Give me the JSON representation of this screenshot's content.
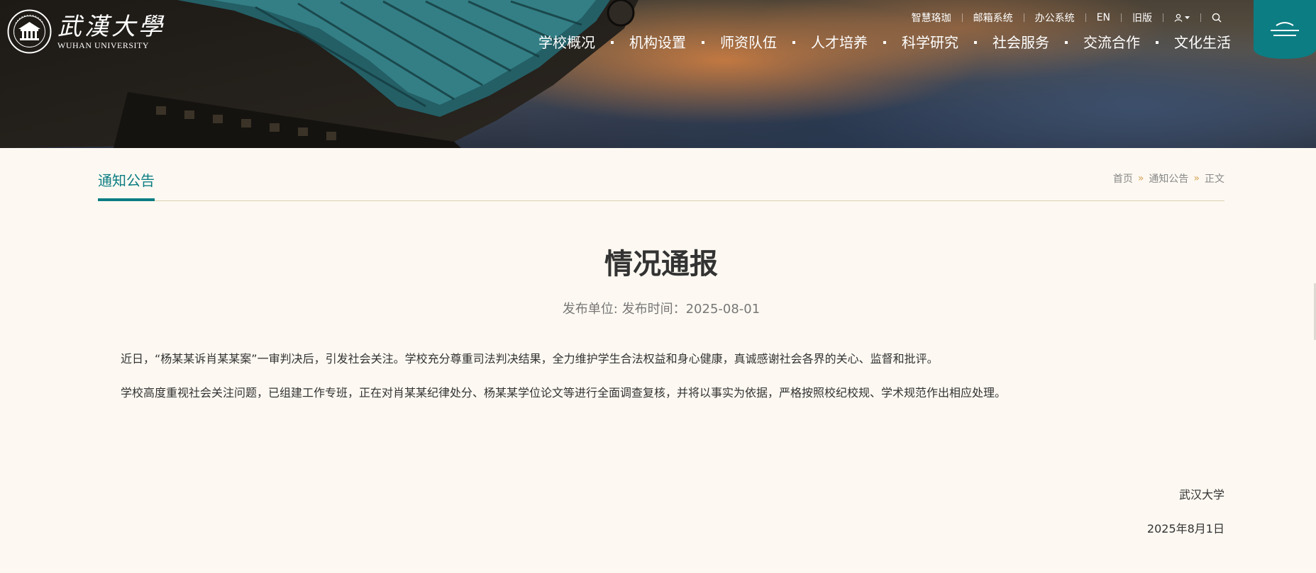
{
  "logo": {
    "cn": "武漢大學",
    "en": "WUHAN UNIVERSITY"
  },
  "topbar": {
    "links": [
      "智慧珞珈",
      "邮箱系统",
      "办公系统",
      "EN",
      "旧版"
    ]
  },
  "nav": {
    "items": [
      "学校概况",
      "机构设置",
      "师资队伍",
      "人才培养",
      "科学研究",
      "社会服务",
      "交流合作",
      "文化生活"
    ]
  },
  "section": {
    "title": "通知公告"
  },
  "breadcrumb": {
    "items": [
      "首页",
      "通知公告",
      "正文"
    ],
    "separator": "»"
  },
  "article": {
    "title": "情况通报",
    "meta": "发布单位:  发布时间：2025-08-01",
    "paragraphs": [
      "近日，“杨某某诉肖某某案”一审判决后，引发社会关注。学校充分尊重司法判决结果，全力维护学生合法权益和身心健康，真诚感谢社会各界的关心、监督和批评。",
      "学校高度重视社会关注问题，已组建工作专班，正在对肖某某纪律处分、杨某某学位论文等进行全面调查复核，并将以事实为依据，严格按照校纪校规、学术规范作出相应处理。"
    ],
    "signature": {
      "org": "武汉大学",
      "date": "2025年8月1日"
    }
  },
  "icons": {
    "user": "user-icon",
    "search": "search-icon",
    "menu": "menu-icon"
  },
  "colors": {
    "accent": "#0b7d83",
    "background": "#fdf9f2",
    "breadcrumb_sep": "#d6a55a"
  }
}
